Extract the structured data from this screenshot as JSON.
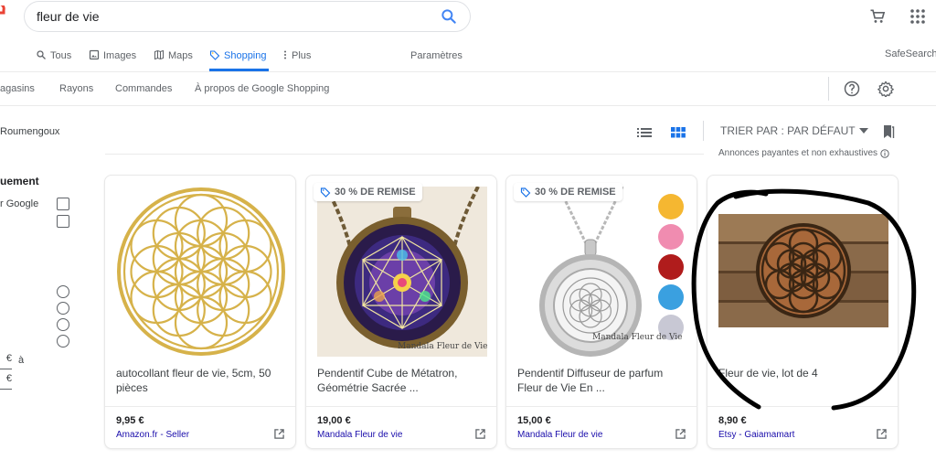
{
  "search": {
    "query": "fleur de vie"
  },
  "tabs": [
    {
      "label": "Tous",
      "icon": "search-icon"
    },
    {
      "label": "Images",
      "icon": "image-icon"
    },
    {
      "label": "Maps",
      "icon": "map-icon"
    },
    {
      "label": "Shopping",
      "icon": "tag-icon",
      "active": true
    },
    {
      "label": "Plus",
      "icon": "more-vert-icon"
    }
  ],
  "settings_label": "Paramètres",
  "safesearch_label": "SafeSearch",
  "shop_nav": [
    "agasins",
    "Rayons",
    "Commandes",
    "À propos de Google Shopping"
  ],
  "left": {
    "location": "Roumengoux",
    "heading": "uement",
    "google_option": "r Google",
    "price_to": "à",
    "price_from_symbol": "€",
    "price_to_symbol": "€"
  },
  "toolbar": {
    "sort_label": "TRIER PAR : PAR DÉFAUT",
    "ads_note": "Annonces payantes et non exhaustives"
  },
  "products": [
    {
      "title": "autocollant fleur de vie, 5cm, 50 pièces",
      "price": "9,95 €",
      "seller": "Amazon.fr - Seller",
      "discount": "",
      "watermark": ""
    },
    {
      "title": "Pendentif Cube de Métatron, Géométrie Sacrée ...",
      "price": "19,00 €",
      "seller": "Mandala Fleur de vie",
      "discount": "30 % DE REMISE",
      "watermark": "Mandala Fleur de Vie"
    },
    {
      "title": "Pendentif Diffuseur de parfum Fleur de Vie En ...",
      "price": "15,00 €",
      "seller": "Mandala Fleur de vie",
      "discount": "30 % DE REMISE",
      "watermark": "Mandala Fleur de Vie"
    },
    {
      "title": "Fleur de vie, lot de 4",
      "price": "8,90 €",
      "seller": "Etsy - Gaiamamart",
      "discount": "",
      "watermark": ""
    }
  ],
  "colors": {
    "accent": "#1a73e8",
    "link": "#1a0dab",
    "gold": "#d6b24a"
  }
}
